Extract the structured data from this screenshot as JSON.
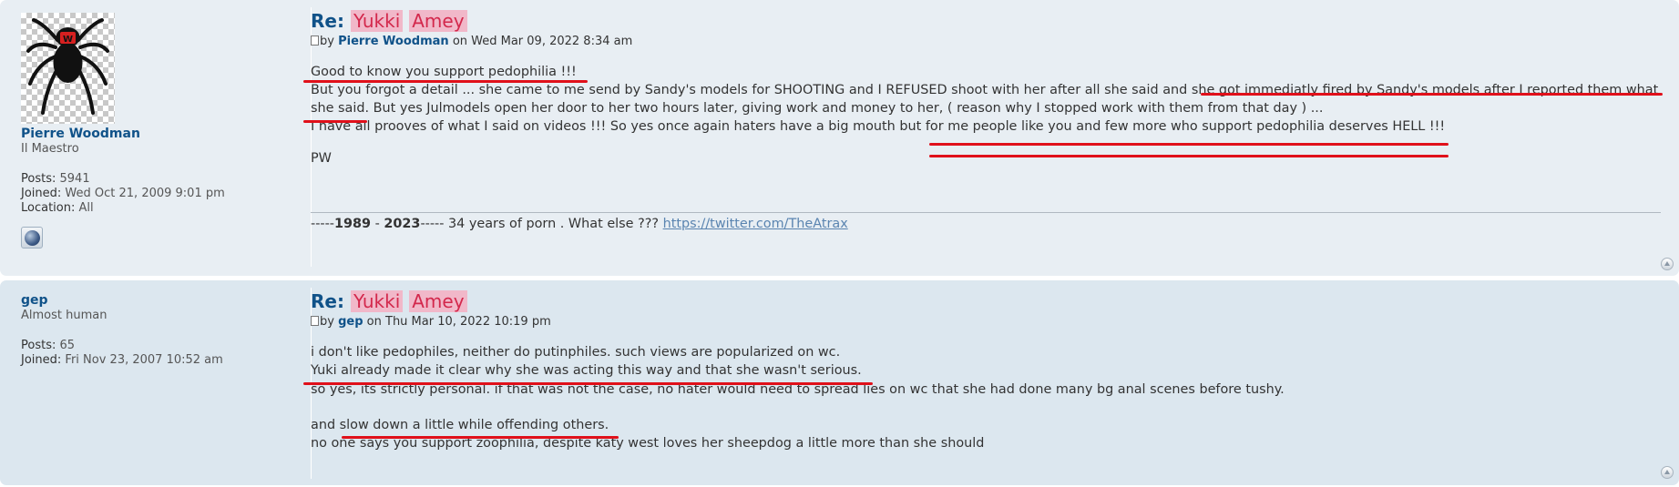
{
  "posts": [
    {
      "profile": {
        "username": "Pierre Woodman",
        "rank": "Il Maestro",
        "posts_label": "Posts:",
        "posts_value": "5941",
        "joined_label": "Joined:",
        "joined_value": "Wed Oct 21, 2009 9:01 pm",
        "location_label": "Location:",
        "location_value": "All",
        "www_icon": "globe-icon"
      },
      "title_prefix": "Re:",
      "title_word1": "Yukki",
      "title_word2": "Amey",
      "author_by": "by",
      "author_name": "Pierre Woodman",
      "author_date": "on Wed Mar 09, 2022 8:34 am",
      "lines": [
        "Good to know you support pedophilia !!!",
        "But you forgot a detail ... she came to me send by Sandy's models for SHOOTING and I REFUSED shoot with her after all she said and she got immediatly fired by Sandy's models after I reported them what",
        "she said. But yes Julmodels open her door to her two hours later, giving work and money to her, ( reason why I stopped work with them from that day ) ...",
        "I have all prooves of what I said on videos !!! So yes once again haters have a big mouth but for me people like you and few more who support pedophilia deserves HELL !!!",
        "",
        "PW"
      ],
      "signature": {
        "dashes_before": "-----",
        "year_start": "1989",
        "mid": " - ",
        "year_end": "2023",
        "dashes_after": "----- 34 years of porn . What else ??? ",
        "link": "https://twitter.com/TheAtrax"
      }
    },
    {
      "profile": {
        "username": "gep",
        "rank": "Almost human",
        "posts_label": "Posts:",
        "posts_value": "65",
        "joined_label": "Joined:",
        "joined_value": "Fri Nov 23, 2007 10:52 am"
      },
      "title_prefix": "Re:",
      "title_word1": "Yukki",
      "title_word2": "Amey",
      "author_by": "by",
      "author_name": "gep",
      "author_date": "on Thu Mar 10, 2022 10:19 pm",
      "lines": [
        "i don't like pedophiles, neither do putinphiles. such views are popularized on wc.",
        "Yuki already made it clear why she was acting this way and that she wasn't serious.",
        "so yes, its strictly personal. if that was not the case, no hater would need to spread lies on wc that she had done many bg anal scenes before tushy.",
        "",
        "and slow down a little while offending others.",
        "no one says you support zoophilia, despite katy west loves her sheepdog a little more than she should"
      ]
    }
  ],
  "colors": {
    "post_bg1": "#e8eef3",
    "post_bg2": "#dce7ef",
    "username": "#105289",
    "highlight_bg": "#f1b8c9",
    "highlight_text": "#d3284c",
    "annotation_red": "#e0101a"
  }
}
